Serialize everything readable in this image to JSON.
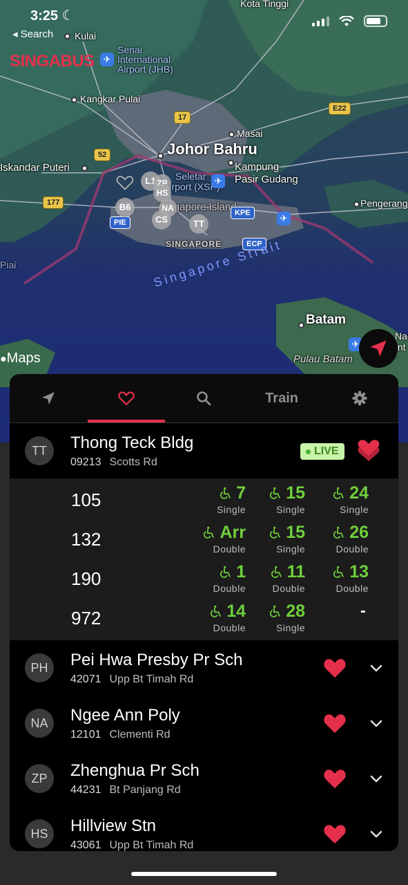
{
  "status_bar": {
    "time": "3:25"
  },
  "nav": {
    "back_label": "◂ Search"
  },
  "brand": "SINGABUS",
  "map": {
    "labels": {
      "kota_tinggi": "Kota Tinggi",
      "kulai": "Kulai",
      "senai": "Senai",
      "senai2": "International",
      "senai3": "Airport (JHB)",
      "kangkar_pulai": "Kangkar Pulai",
      "masai": "Masai",
      "johor_bahru": "Johor Bahru",
      "iskandar_puteri": "Iskandar Puteri",
      "kampung": "Kampung",
      "pasir_gudang": "Pasir Gudang",
      "seletar": "Seletar",
      "seletar2": "Airport (XSP)",
      "singapore_island": "Singapore Island",
      "singapore": "SINGAPORE",
      "pengerang": "Pengerang",
      "singapore_strait": "Singapore Strait",
      "batam": "Batam",
      "pulau_batam": "Pulau Batam",
      "piai": "Piai",
      "nac": "Nac",
      "int": "Int"
    },
    "shields": {
      "e22": "E22",
      "r17": "17",
      "r52": "52",
      "r177": "177",
      "pie": "PIE",
      "kpe": "KPE",
      "ecp": "ECP"
    },
    "pins": [
      "L1",
      "ZP",
      "HS",
      "NA",
      "B6",
      "CS",
      "TT"
    ],
    "credit": "Maps",
    "colors": {
      "water": "#20306e",
      "land": "#2c5858",
      "urban": "#6e7280"
    }
  },
  "tabs": [
    {
      "name": "nearby",
      "icon": "location-arrow-icon",
      "label": ""
    },
    {
      "name": "favorites",
      "icon": "heart-icon",
      "label": ""
    },
    {
      "name": "search",
      "icon": "search-icon",
      "label": ""
    },
    {
      "name": "train",
      "icon": "",
      "label": "Train"
    },
    {
      "name": "settings",
      "icon": "gear-icon",
      "label": ""
    }
  ],
  "expanded_stop": {
    "abbr": "TT",
    "name": "Thong Teck Bldg",
    "code": "09213",
    "road": "Scotts Rd",
    "live_label": "LIVE",
    "services": [
      {
        "no": "105",
        "arrivals": [
          {
            "min": "7",
            "deck": "Single"
          },
          {
            "min": "15",
            "deck": "Single"
          },
          {
            "min": "24",
            "deck": "Single"
          }
        ]
      },
      {
        "no": "132",
        "arrivals": [
          {
            "min": "Arr",
            "deck": "Double"
          },
          {
            "min": "15",
            "deck": "Single"
          },
          {
            "min": "26",
            "deck": "Double"
          }
        ]
      },
      {
        "no": "190",
        "arrivals": [
          {
            "min": "1",
            "deck": "Double"
          },
          {
            "min": "11",
            "deck": "Double"
          },
          {
            "min": "13",
            "deck": "Double"
          }
        ]
      },
      {
        "no": "972",
        "arrivals": [
          {
            "min": "14",
            "deck": "Double"
          },
          {
            "min": "28",
            "deck": "Single"
          },
          {
            "min": "-",
            "deck": ""
          }
        ]
      }
    ]
  },
  "stops": [
    {
      "abbr": "PH",
      "name": "Pei Hwa Presby Pr Sch",
      "code": "42071",
      "road": "Upp Bt Timah Rd"
    },
    {
      "abbr": "NA",
      "name": "Ngee Ann Poly",
      "code": "12101",
      "road": "Clementi Rd"
    },
    {
      "abbr": "ZP",
      "name": "Zhenghua Pr Sch",
      "code": "44231",
      "road": "Bt Panjang Rd"
    },
    {
      "abbr": "HS",
      "name": "Hillview Stn",
      "code": "43061",
      "road": "Upp Bt Timah Rd"
    }
  ],
  "accent_colors": {
    "brand_red": "#e5304c",
    "eta_green": "#6fcf3c",
    "live_bg": "#c9f3a8"
  }
}
